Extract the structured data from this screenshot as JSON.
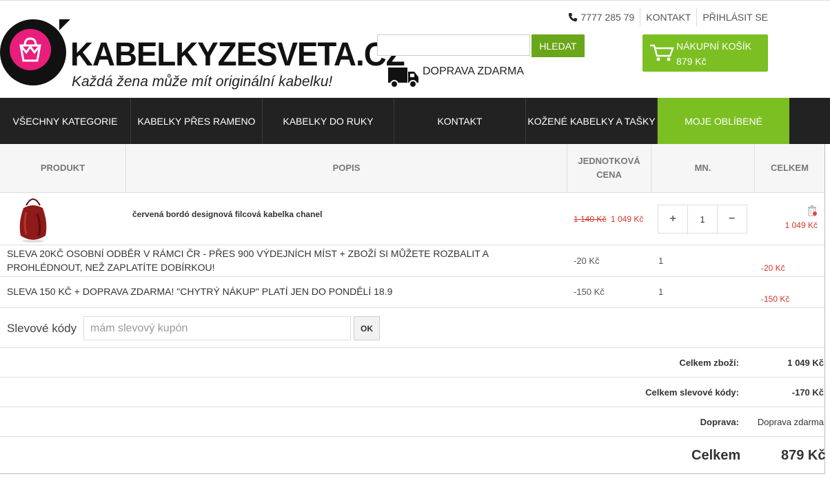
{
  "header": {
    "phone": "7777 285 79",
    "contact_link": "KONTAKT",
    "login_link": "PŘIHLÁSIT SE",
    "logo_text": "KABELKYZESVETA.CZ",
    "slogan": "Každá žena může mít originální kabelku!",
    "search_button": "HLEDAT",
    "search_value": "",
    "shipping": "DOPRAVA ZDARMA",
    "cart_label": "NÁKUPNÍ KOŠÍK",
    "cart_total": "879 Kč"
  },
  "nav": [
    {
      "label": "VŠECHNY KATEGORIE"
    },
    {
      "label": "KABELKY PŘES RAMENO"
    },
    {
      "label": "KABELKY DO RUKY"
    },
    {
      "label": "KONTAKT"
    },
    {
      "label": "KOŽENÉ KABELKY A TAŠKY"
    },
    {
      "label": "MOJE OBLÍBENÉ"
    }
  ],
  "table": {
    "headers": {
      "product": "PRODUKT",
      "description": "POPIS",
      "unit_price_1": "JEDNOTKOVÁ",
      "unit_price_2": "CENA",
      "qty": "MN.",
      "total": "CELKEM"
    },
    "item": {
      "name": "červená bordó designová filcová kabelka chanel",
      "old_price": "1 140 Kč",
      "price": "1 049 Kč",
      "qty": "1",
      "plus": "+",
      "minus": "−",
      "total": "1 049 Kč"
    },
    "discounts": [
      {
        "text": "SLEVA 20KČ OSOBNÍ ODBĚR V RÁMCI ČR - PŘES 900 VÝDEJNÍCH MÍST + ZBOŽÍ SI MŮŽETE ROZBALIT A PROHLÉDNOUT, NEŽ ZAPLATÍTE DOBÍRKOU!",
        "price": "-20 Kč",
        "qty": "1",
        "total": "-20 Kč"
      },
      {
        "text": "SLEVA 150 KČ + DOPRAVA ZDARMA! \"CHYTRÝ NÁKUP\" PLATÍ JEN DO PONDĚLÍ 18.9",
        "price": "-150 Kč",
        "qty": "1",
        "total": "-150 Kč"
      }
    ]
  },
  "coupon": {
    "label": "Slevové kódy",
    "placeholder": "mám slevový kupón",
    "button": "OK"
  },
  "summary": {
    "goods_label": "Celkem zboží:",
    "goods_value": "1 049 Kč",
    "codes_label": "Celkem slevové kódy:",
    "codes_value": "-170 Kč",
    "shipping_label": "Doprava:",
    "shipping_value": "Doprava zdarma",
    "grand_label": "Celkem",
    "grand_value": "879 Kč"
  },
  "colors": {
    "accent_green": "#7bbf22",
    "price_red": "#d9352b",
    "nav_dark": "#222222",
    "logo_pink": "#e91e7a"
  }
}
